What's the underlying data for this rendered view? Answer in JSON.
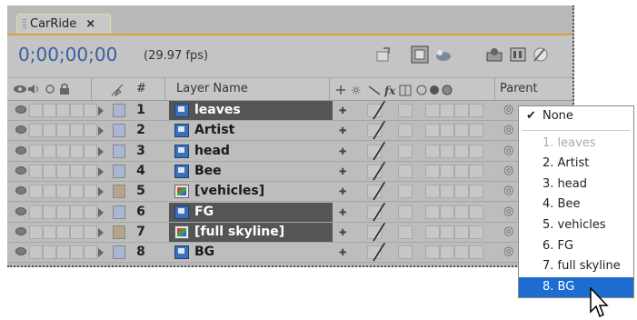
{
  "tab": {
    "title": "CarRide",
    "close": "×"
  },
  "timeline": {
    "timecode": "0;00;00;00",
    "fps": "(29.97 fps)"
  },
  "header": {
    "hash": "#",
    "layer_name": "Layer Name",
    "parent": "Parent"
  },
  "layers": [
    {
      "num": "1",
      "name": "leaves",
      "type": "ai",
      "swatch": "#a9b6d4",
      "selected": true
    },
    {
      "num": "2",
      "name": "Artist",
      "type": "ai",
      "swatch": "#a9b6d4",
      "selected": false
    },
    {
      "num": "3",
      "name": "head",
      "type": "ai",
      "swatch": "#a9b6d4",
      "selected": false
    },
    {
      "num": "4",
      "name": "Bee",
      "type": "ai",
      "swatch": "#a9b6d4",
      "selected": false
    },
    {
      "num": "5",
      "name": "[vehicles]",
      "type": "comp",
      "swatch": "#b5a48a",
      "selected": false
    },
    {
      "num": "6",
      "name": "FG",
      "type": "ai",
      "swatch": "#a9b6d4",
      "selected": true
    },
    {
      "num": "7",
      "name": "[full skyline]",
      "type": "comp",
      "swatch": "#b5a48a",
      "selected": true
    },
    {
      "num": "8",
      "name": "BG",
      "type": "ai",
      "swatch": "#a9b6d4",
      "selected": false
    }
  ],
  "parent_menu": {
    "none_label": "None",
    "check": "✔",
    "items": [
      {
        "label": "1. leaves",
        "state": "disabled"
      },
      {
        "label": "2. Artist",
        "state": "normal"
      },
      {
        "label": "3. head",
        "state": "normal"
      },
      {
        "label": "4. Bee",
        "state": "normal"
      },
      {
        "label": "5. vehicles",
        "state": "normal"
      },
      {
        "label": "6. FG",
        "state": "normal"
      },
      {
        "label": "7. full skyline",
        "state": "normal"
      },
      {
        "label": "8. BG",
        "state": "active"
      }
    ]
  },
  "icons": {
    "tab_grip": "grip-icon",
    "eye": "eye-icon",
    "audio": "speaker-icon",
    "solo": "solo-icon",
    "lock": "lock-icon",
    "label": "label-tag-icon",
    "expand": "expand-triangle-icon",
    "layer_ai": "illustrator-layer-icon",
    "layer_comp": "precomp-layer-icon",
    "pen": "pen-stroke-icon",
    "pickwhip": "pickwhip-spiral-icon",
    "cursor": "mouse-pointer-icon"
  },
  "colors": {
    "timecode": "#3a5fa6",
    "menu_highlight": "#1d6ccf",
    "tab_accent": "#d8a238"
  }
}
